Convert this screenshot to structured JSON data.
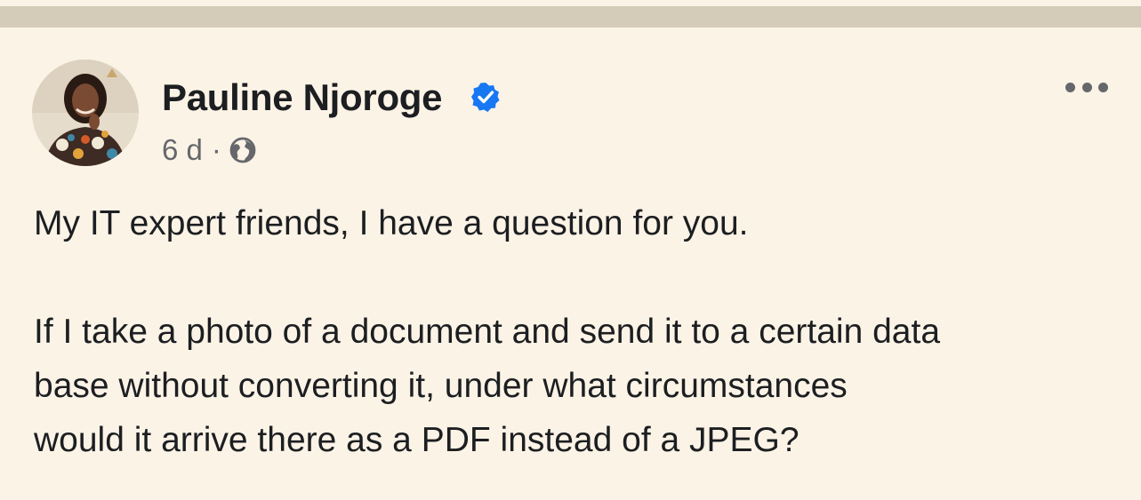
{
  "post": {
    "author": {
      "name": "Pauline Njoroge",
      "verified": true
    },
    "meta": {
      "time": "6 d",
      "separator": "·",
      "audience_icon": "globe-icon"
    },
    "more_icon": "more-horizontal-icon",
    "text": {
      "paragraph1": "My IT expert friends, I have a question for you.",
      "paragraph2_lines": [
        "If I take a photo of a document and send it to a certain data",
        "base without converting it, under what circumstances",
        "would it arrive there as a PDF instead of a JPEG?"
      ]
    }
  },
  "colors": {
    "background": "#fbf3e6",
    "divider": "#d5cbb9",
    "text_primary": "#1c1e21",
    "text_secondary": "#65676b",
    "verified_blue": "#1877f2"
  }
}
